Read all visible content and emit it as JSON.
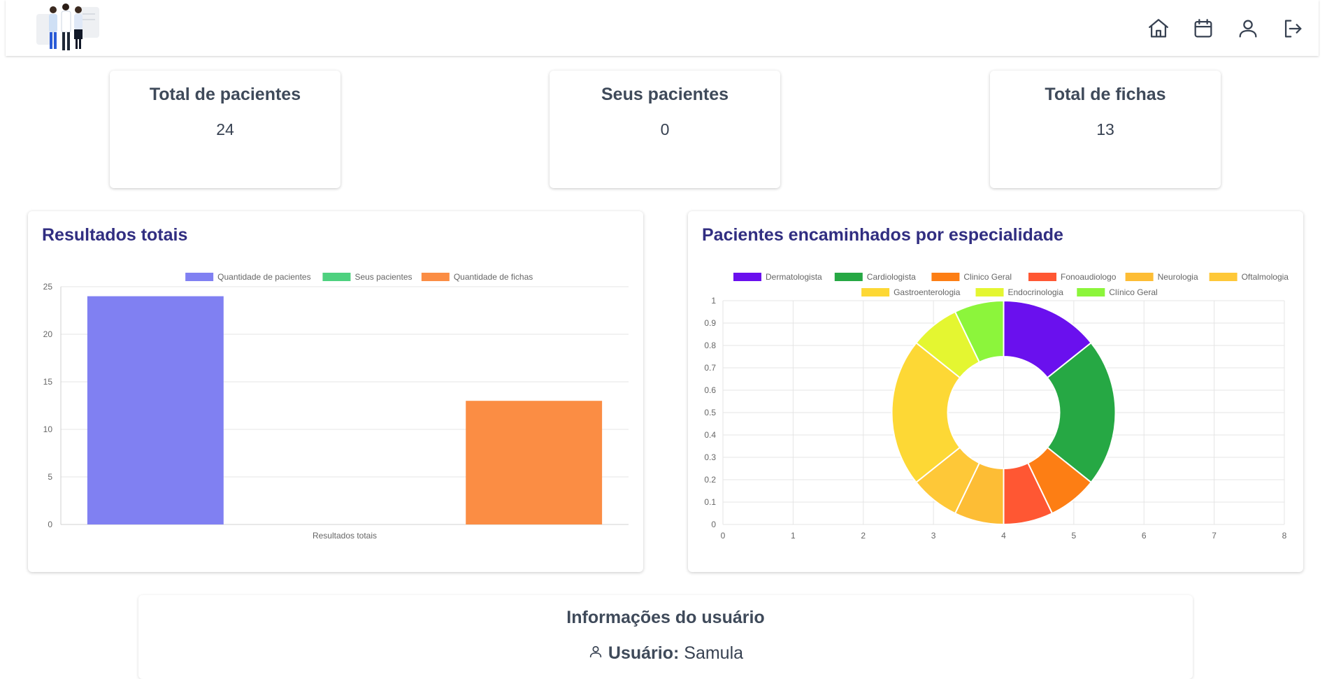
{
  "header": {
    "logo_icon": "doctors-illustration",
    "nav": [
      {
        "name": "home",
        "icon": "home-icon"
      },
      {
        "name": "calendar",
        "icon": "calendar-icon"
      },
      {
        "name": "profile",
        "icon": "user-icon"
      },
      {
        "name": "logout",
        "icon": "logout-icon"
      }
    ]
  },
  "stats": [
    {
      "title": "Total de pacientes",
      "value": "24"
    },
    {
      "title": "Seus pacientes",
      "value": "0"
    },
    {
      "title": "Total de fichas",
      "value": "13"
    }
  ],
  "panels": {
    "left_title": "Resultados totais",
    "right_title": "Pacientes encaminhados por especialidade"
  },
  "user_info": {
    "title": "Informações do usuário",
    "user_label": "Usuário:",
    "user_value": "Samula",
    "user_icon": "user-icon"
  },
  "chart_data": [
    {
      "type": "bar",
      "categories": [
        "Resultados totais"
      ],
      "series": [
        {
          "name": "Quantidade de pacientes",
          "values": [
            24
          ],
          "color": "#8080f2"
        },
        {
          "name": "Seus pacientes",
          "values": [
            0
          ],
          "color": "#4ed17f"
        },
        {
          "name": "Quantidade de fichas",
          "values": [
            13
          ],
          "color": "#fb8d44"
        }
      ],
      "ylim": [
        0,
        25
      ],
      "yticks": [
        0,
        5,
        10,
        15,
        20,
        25
      ],
      "legend": "top",
      "grid": true
    },
    {
      "type": "pie",
      "variant": "doughnut",
      "labels": [
        "Dermatologista",
        "Cardiologista",
        "Clinico Geral",
        "Fonoaudiologo",
        "Neurologia",
        "Oftalmologia",
        "Gastroenterologia",
        "Endocrinologia",
        "Clínico Geral"
      ],
      "values": [
        2,
        3,
        1,
        1,
        1,
        1,
        3,
        1,
        1
      ],
      "colors": [
        "#6a10ee",
        "#26a844",
        "#fd7e14",
        "#ff5733",
        "#fdbd35",
        "#fec838",
        "#fdd835",
        "#e4f631",
        "#8cf53b"
      ],
      "xticks": [
        0,
        1,
        2,
        3,
        4,
        5,
        6,
        7,
        8
      ],
      "yticks": [
        0,
        0.1,
        0.2,
        0.3,
        0.4,
        0.5,
        0.6,
        0.7,
        0.8,
        0.9,
        1
      ],
      "legend": "top",
      "grid": true
    }
  ]
}
